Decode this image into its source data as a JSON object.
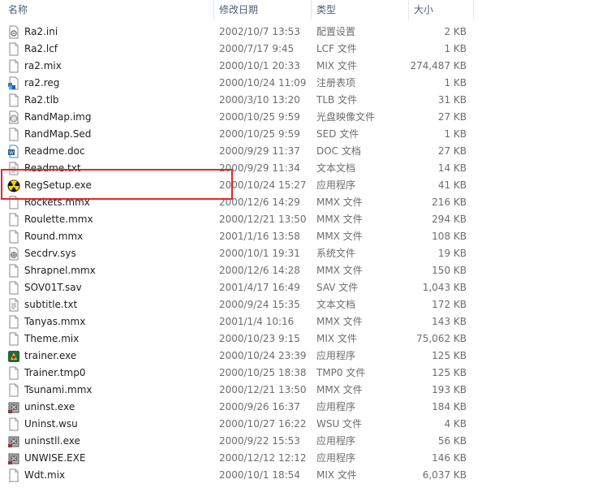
{
  "columns": {
    "name": "名称",
    "date": "修改日期",
    "type": "类型",
    "size": "大小"
  },
  "files": [
    {
      "name": "Ra2.ini",
      "date": "2002/10/7 13:53",
      "type": "配置设置",
      "size": "2 KB",
      "icon": "settings-file-icon"
    },
    {
      "name": "Ra2.lcf",
      "date": "2000/7/17 9:45",
      "type": "LCF 文件",
      "size": "1 KB",
      "icon": "generic-file-icon"
    },
    {
      "name": "ra2.mix",
      "date": "2000/10/1 20:33",
      "type": "MIX 文件",
      "size": "274,487 KB",
      "icon": "generic-file-icon"
    },
    {
      "name": "ra2.reg",
      "date": "2000/10/24 11:09",
      "type": "注册表项",
      "size": "1 KB",
      "icon": "registry-file-icon"
    },
    {
      "name": "Ra2.tlb",
      "date": "2000/3/10 13:20",
      "type": "TLB 文件",
      "size": "31 KB",
      "icon": "generic-file-icon"
    },
    {
      "name": "RandMap.img",
      "date": "2000/10/25 9:59",
      "type": "光盘映像文件",
      "size": "27 KB",
      "icon": "disc-image-icon"
    },
    {
      "name": "RandMap.Sed",
      "date": "2000/10/25 9:59",
      "type": "SED 文件",
      "size": "1 KB",
      "icon": "generic-file-icon"
    },
    {
      "name": "Readme.doc",
      "date": "2000/9/29 11:37",
      "type": "DOC 文档",
      "size": "27 KB",
      "icon": "word-document-icon"
    },
    {
      "name": "Readme.txt",
      "date": "2000/9/29 11:34",
      "type": "文本文档",
      "size": "14 KB",
      "icon": "text-file-icon"
    },
    {
      "name": "RegSetup.exe",
      "date": "2000/10/24 15:27",
      "type": "应用程序",
      "size": "41 KB",
      "icon": "radiation-app-icon"
    },
    {
      "name": "Rockets.mmx",
      "date": "2000/12/6 14:29",
      "type": "MMX 文件",
      "size": "216 KB",
      "icon": "generic-file-icon"
    },
    {
      "name": "Roulette.mmx",
      "date": "2000/12/21 13:50",
      "type": "MMX 文件",
      "size": "294 KB",
      "icon": "generic-file-icon"
    },
    {
      "name": "Round.mmx",
      "date": "2001/1/16 13:58",
      "type": "MMX 文件",
      "size": "108 KB",
      "icon": "generic-file-icon"
    },
    {
      "name": "Secdrv.sys",
      "date": "2000/10/1 19:31",
      "type": "系统文件",
      "size": "19 KB",
      "icon": "system-file-icon"
    },
    {
      "name": "Shrapnel.mmx",
      "date": "2000/12/6 14:28",
      "type": "MMX 文件",
      "size": "150 KB",
      "icon": "generic-file-icon"
    },
    {
      "name": "SOV01T.sav",
      "date": "2001/4/17 16:49",
      "type": "SAV 文件",
      "size": "1,043 KB",
      "icon": "generic-file-icon"
    },
    {
      "name": "subtitle.txt",
      "date": "2000/9/24 15:35",
      "type": "文本文档",
      "size": "172 KB",
      "icon": "text-file-icon"
    },
    {
      "name": "Tanyas.mmx",
      "date": "2001/1/4 10:16",
      "type": "MMX 文件",
      "size": "143 KB",
      "icon": "generic-file-icon"
    },
    {
      "name": "Theme.mix",
      "date": "2000/10/23 9:15",
      "type": "MIX 文件",
      "size": "75,062 KB",
      "icon": "generic-file-icon"
    },
    {
      "name": "trainer.exe",
      "date": "2000/10/24 23:39",
      "type": "应用程序",
      "size": "125 KB",
      "icon": "trainer-app-icon"
    },
    {
      "name": "Trainer.tmp0",
      "date": "2000/10/25 18:38",
      "type": "TMP0 文件",
      "size": "125 KB",
      "icon": "generic-file-icon"
    },
    {
      "name": "Tsunami.mmx",
      "date": "2000/12/21 13:50",
      "type": "MMX 文件",
      "size": "193 KB",
      "icon": "generic-file-icon"
    },
    {
      "name": "uninst.exe",
      "date": "2000/9/26 16:37",
      "type": "应用程序",
      "size": "184 KB",
      "icon": "installer-app-icon"
    },
    {
      "name": "Uninst.wsu",
      "date": "2000/10/27 16:22",
      "type": "WSU 文件",
      "size": "4 KB",
      "icon": "generic-file-icon"
    },
    {
      "name": "uninstll.exe",
      "date": "2000/9/22 15:53",
      "type": "应用程序",
      "size": "56 KB",
      "icon": "installer-app-icon"
    },
    {
      "name": "UNWISE.EXE",
      "date": "2000/12/12 12:12",
      "type": "应用程序",
      "size": "146 KB",
      "icon": "installer-app-icon"
    },
    {
      "name": "Wdt.mix",
      "date": "2000/10/1 18:54",
      "type": "MIX 文件",
      "size": "6,037 KB",
      "icon": "generic-file-icon"
    }
  ]
}
